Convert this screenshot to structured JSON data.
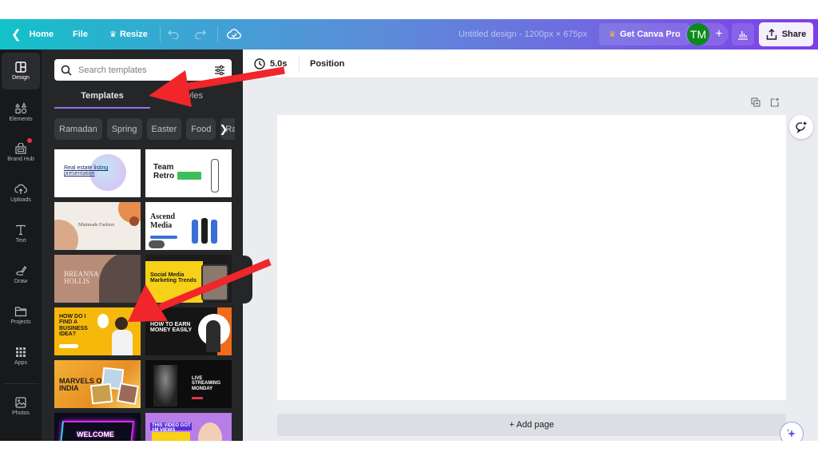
{
  "topbar": {
    "home_label": "Home",
    "file_label": "File",
    "resize_label": "Resize",
    "design_title": "Untitled design - 1200px × 675px",
    "pro_label": "Get Canva Pro",
    "avatar_initials": "TM",
    "plus_label": "+",
    "share_label": "Share"
  },
  "rail": {
    "items": [
      {
        "label": "Design",
        "icon": "layout-icon",
        "active": true
      },
      {
        "label": "Elements",
        "icon": "shapes-icon"
      },
      {
        "label": "Brand Hub",
        "icon": "brand-icon",
        "notification": true
      },
      {
        "label": "Uploads",
        "icon": "cloud-upload-icon"
      },
      {
        "label": "Text",
        "icon": "text-icon"
      },
      {
        "label": "Draw",
        "icon": "pen-icon"
      },
      {
        "label": "Projects",
        "icon": "folder-icon"
      },
      {
        "label": "Apps",
        "icon": "grid-icon"
      },
      {
        "label": "Photos",
        "icon": "image-icon"
      }
    ]
  },
  "panel": {
    "search_placeholder": "Search templates",
    "tabs": [
      {
        "label": "Templates",
        "active": true
      },
      {
        "label": "Styles"
      }
    ],
    "chips": [
      "Ramadan",
      "Spring",
      "Easter",
      "Food",
      "Ra"
    ],
    "templates": [
      {
        "title": "Real estate listing presentation"
      },
      {
        "title": "Team Retro"
      },
      {
        "title": "Mintmade Fashion"
      },
      {
        "title": "Ascend Media"
      },
      {
        "title": "BREANNA HOLLIS"
      },
      {
        "title": "Social Media Marketing Trends"
      },
      {
        "title": "HOW DO I FIND A BUSINESS IDEA?"
      },
      {
        "title": "HOW TO EARN MONEY EASILY"
      },
      {
        "title": "MARVELS OF INDIA"
      },
      {
        "title": "LIVE STREAMING MONDAY"
      },
      {
        "title": "WELCOME"
      },
      {
        "title": "THIS VIDEO GOT 1M VIEWS"
      }
    ]
  },
  "editor": {
    "duration": "5.0s",
    "position_label": "Position",
    "add_page_label": "+ Add page"
  },
  "colors": {
    "accent": "#8b74e8",
    "avatar_bg": "#0b8a1d",
    "annotation_arrow": "#f0262a"
  }
}
